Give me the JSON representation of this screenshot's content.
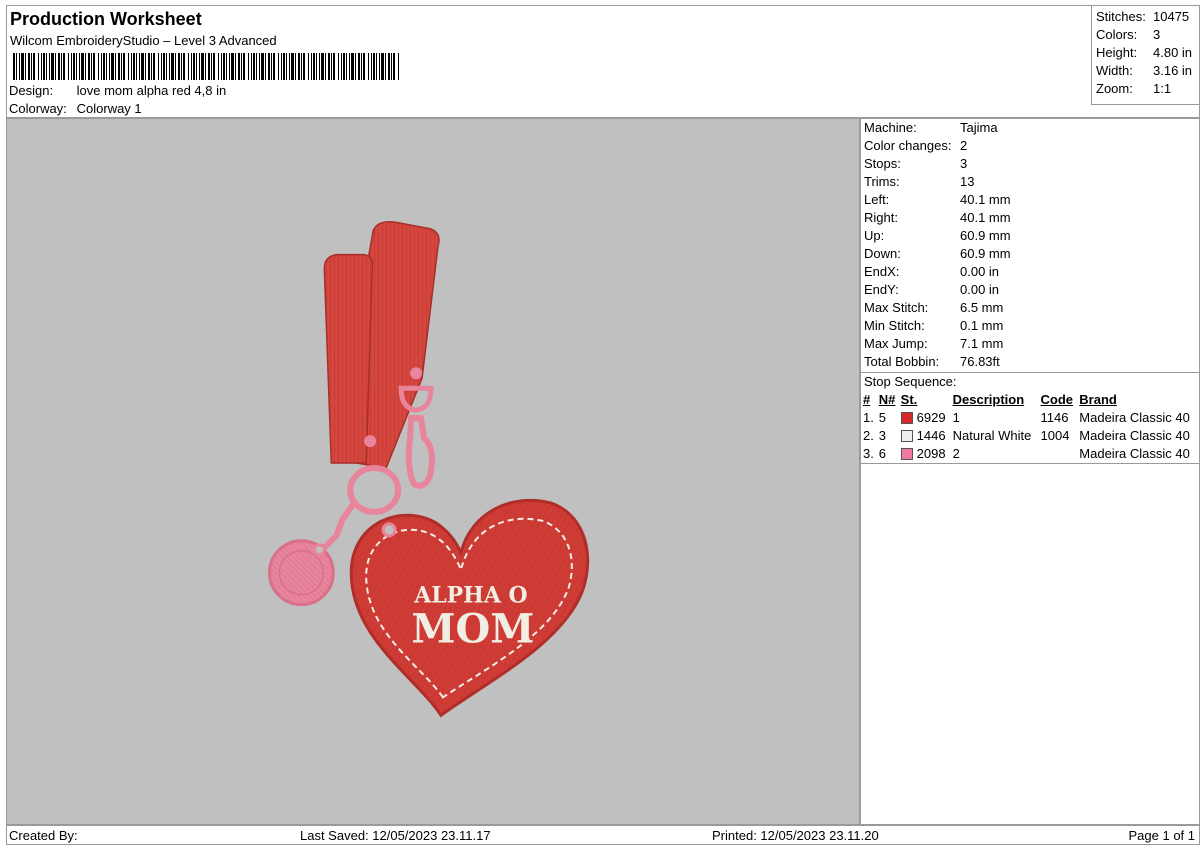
{
  "header": {
    "title": "Production Worksheet",
    "subtitle": "Wilcom EmbroideryStudio – Level 3 Advanced",
    "design_label": "Design:",
    "design_value": "love mom alpha red 4,8 in",
    "colorway_label": "Colorway:",
    "colorway_value": "Colorway 1"
  },
  "summary": [
    {
      "label": "Stitches:",
      "value": "10475"
    },
    {
      "label": "Colors:",
      "value": "3"
    },
    {
      "label": "Height:",
      "value": "4.80 in"
    },
    {
      "label": "Width:",
      "value": "3.16 in"
    },
    {
      "label": "Zoom:",
      "value": "1:1"
    }
  ],
  "details": [
    {
      "label": "Machine:",
      "value": "Tajima"
    },
    {
      "label": "Color changes:",
      "value": "2"
    },
    {
      "label": "Stops:",
      "value": "3"
    },
    {
      "label": "Trims:",
      "value": "13"
    },
    {
      "label": "Left:",
      "value": "40.1 mm"
    },
    {
      "label": "Right:",
      "value": "40.1 mm"
    },
    {
      "label": "Up:",
      "value": "60.9 mm"
    },
    {
      "label": "Down:",
      "value": "60.9 mm"
    },
    {
      "label": "EndX:",
      "value": "0.00 in"
    },
    {
      "label": "EndY:",
      "value": "0.00 in"
    },
    {
      "label": "Max Stitch:",
      "value": "6.5 mm"
    },
    {
      "label": "Min Stitch:",
      "value": "0.1 mm"
    },
    {
      "label": "Max Jump:",
      "value": "7.1 mm"
    },
    {
      "label": "Total Bobbin:",
      "value": "76.83ft"
    }
  ],
  "stop_sequence": {
    "title": "Stop Sequence:",
    "columns": [
      "#",
      "N#",
      "St.",
      "Description",
      "Code",
      "Brand"
    ],
    "rows": [
      {
        "num": "1.",
        "n": "5",
        "color": "#d42a2a",
        "st": "6929",
        "description": "1",
        "code": "1146",
        "brand": "Madeira Classic 40"
      },
      {
        "num": "2.",
        "n": "3",
        "color": "#eeeeee",
        "st": "1446",
        "description": "Natural White",
        "code": "1004",
        "brand": "Madeira Classic 40"
      },
      {
        "num": "3.",
        "n": "6",
        "color": "#f07aa0",
        "st": "2098",
        "description": "2",
        "code": "",
        "brand": "Madeira Classic 40"
      }
    ]
  },
  "design_text": {
    "line1": "ALPHA O",
    "line2": "MOM"
  },
  "footer": {
    "created_by": "Created By:",
    "last_saved": "Last Saved: 12/05/2023 23.11.17",
    "printed": "Printed: 12/05/2023 23.11.20",
    "page": "Page 1 of 1"
  },
  "colors": {
    "strap_red": "#d4463e",
    "heart_red": "#d03a34",
    "pink": "#e8849c",
    "natural_white": "#f1eee4",
    "preview_bg": "#c0c0c0"
  }
}
